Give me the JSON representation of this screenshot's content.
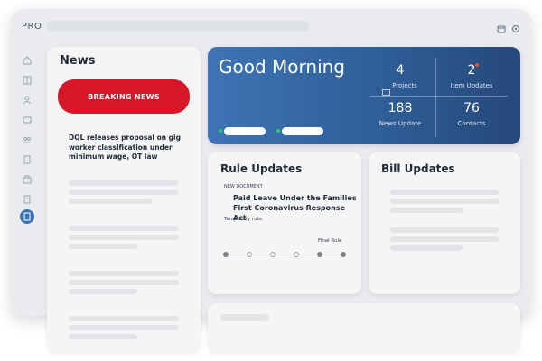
{
  "app": {
    "logo": "PRO"
  },
  "icons": {
    "top": [
      "calendar-icon",
      "gear-icon"
    ],
    "sidebar": [
      "home-icon",
      "grid-icon",
      "people-icon",
      "card-icon",
      "group-icon",
      "building-icon",
      "briefcase-icon",
      "document-icon",
      "news-icon"
    ]
  },
  "news": {
    "title": "News",
    "breaking_label": "BREAKING NEWS",
    "headline": "DOL releases proposal on gig worker classification under minimum wage, OT law"
  },
  "hero": {
    "greeting": "Good Morning",
    "stats": [
      {
        "value": "4",
        "label": "Projects"
      },
      {
        "value": "2",
        "label": "Item Updates"
      },
      {
        "value": "188",
        "label": "News Update"
      },
      {
        "value": "76",
        "label": "Contacts"
      }
    ]
  },
  "rule_updates": {
    "title": "Rule Updates",
    "doc_label": "NEW DOCUMENT",
    "doc_title": "Paid Leave Under the Families First Coronavirus Response Act",
    "doc_sub": "Temporary rule.",
    "stage": "Final Rule",
    "progress": {
      "completed_steps": 5,
      "total_steps": 6
    }
  },
  "bill_updates": {
    "title": "Bill Updates"
  },
  "colors": {
    "accent": "#2f5e98",
    "breaking": "#d6172a"
  }
}
